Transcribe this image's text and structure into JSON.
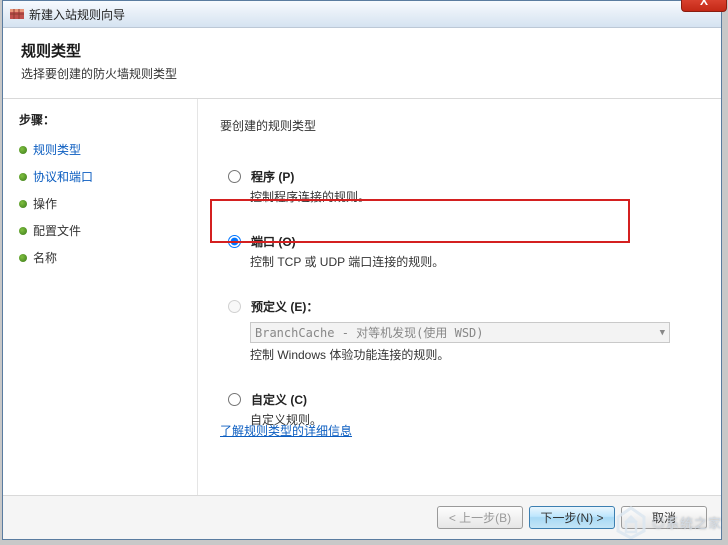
{
  "window": {
    "title": "新建入站规则向导",
    "close": "X"
  },
  "header": {
    "title": "规则类型",
    "subtitle": "选择要创建的防火墙规则类型"
  },
  "sidebar": {
    "steps_label": "步骤：",
    "steps": [
      {
        "label": "规则类型"
      },
      {
        "label": "协议和端口"
      },
      {
        "label": "操作"
      },
      {
        "label": "配置文件"
      },
      {
        "label": "名称"
      }
    ]
  },
  "content": {
    "heading": "要创建的规则类型",
    "options": {
      "program": {
        "label": "程序 (P)",
        "desc": "控制程序连接的规则。"
      },
      "port": {
        "label": "端口 (O)",
        "desc": "控制 TCP 或 UDP 端口连接的规则。"
      },
      "predefined": {
        "label": "预定义 (E)：",
        "dropdown": "BranchCache - 对等机发现(使用 WSD)",
        "desc": "控制 Windows 体验功能连接的规则。"
      },
      "custom": {
        "label": "自定义 (C)",
        "desc": "自定义规则。"
      }
    },
    "more_link": "了解规则类型的详细信息"
  },
  "footer": {
    "back": "< 上一步(B)",
    "next": "下一步(N) >",
    "cancel": "取消"
  },
  "watermark": "◎系统之家"
}
